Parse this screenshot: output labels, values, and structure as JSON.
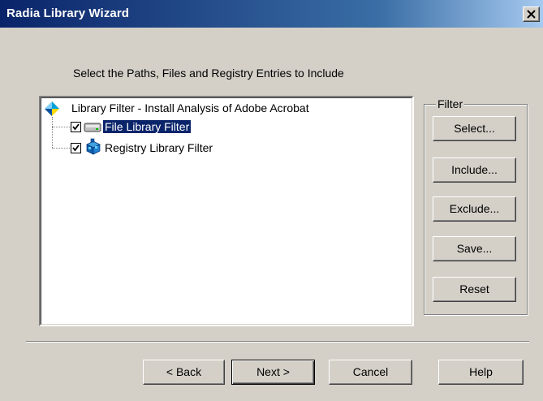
{
  "window": {
    "title": "Radia Library Wizard",
    "close_glyph": "×"
  },
  "instruction": "Select the Paths, Files and Registry Entries to Include",
  "tree": {
    "root": {
      "label": "Library Filter - Install Analysis of Adobe Acrobat",
      "icon": "library-filter-icon"
    },
    "children": [
      {
        "label": "File Library Filter",
        "checked": true,
        "selected": true,
        "icon": "drive-icon"
      },
      {
        "label": "Registry Library Filter",
        "checked": true,
        "selected": false,
        "icon": "registry-icon"
      }
    ]
  },
  "filter_group": {
    "label": "Filter",
    "buttons": [
      "Select...",
      "Include...",
      "Exclude...",
      "Save...",
      "Reset"
    ]
  },
  "footer": {
    "back": "< Back",
    "next": "Next >",
    "cancel": "Cancel",
    "help": "Help"
  },
  "colors": {
    "title_bar_start": "#0a246a",
    "title_bar_end": "#a6caf0",
    "selection": "#0a246a",
    "face": "#d4d0c8"
  }
}
